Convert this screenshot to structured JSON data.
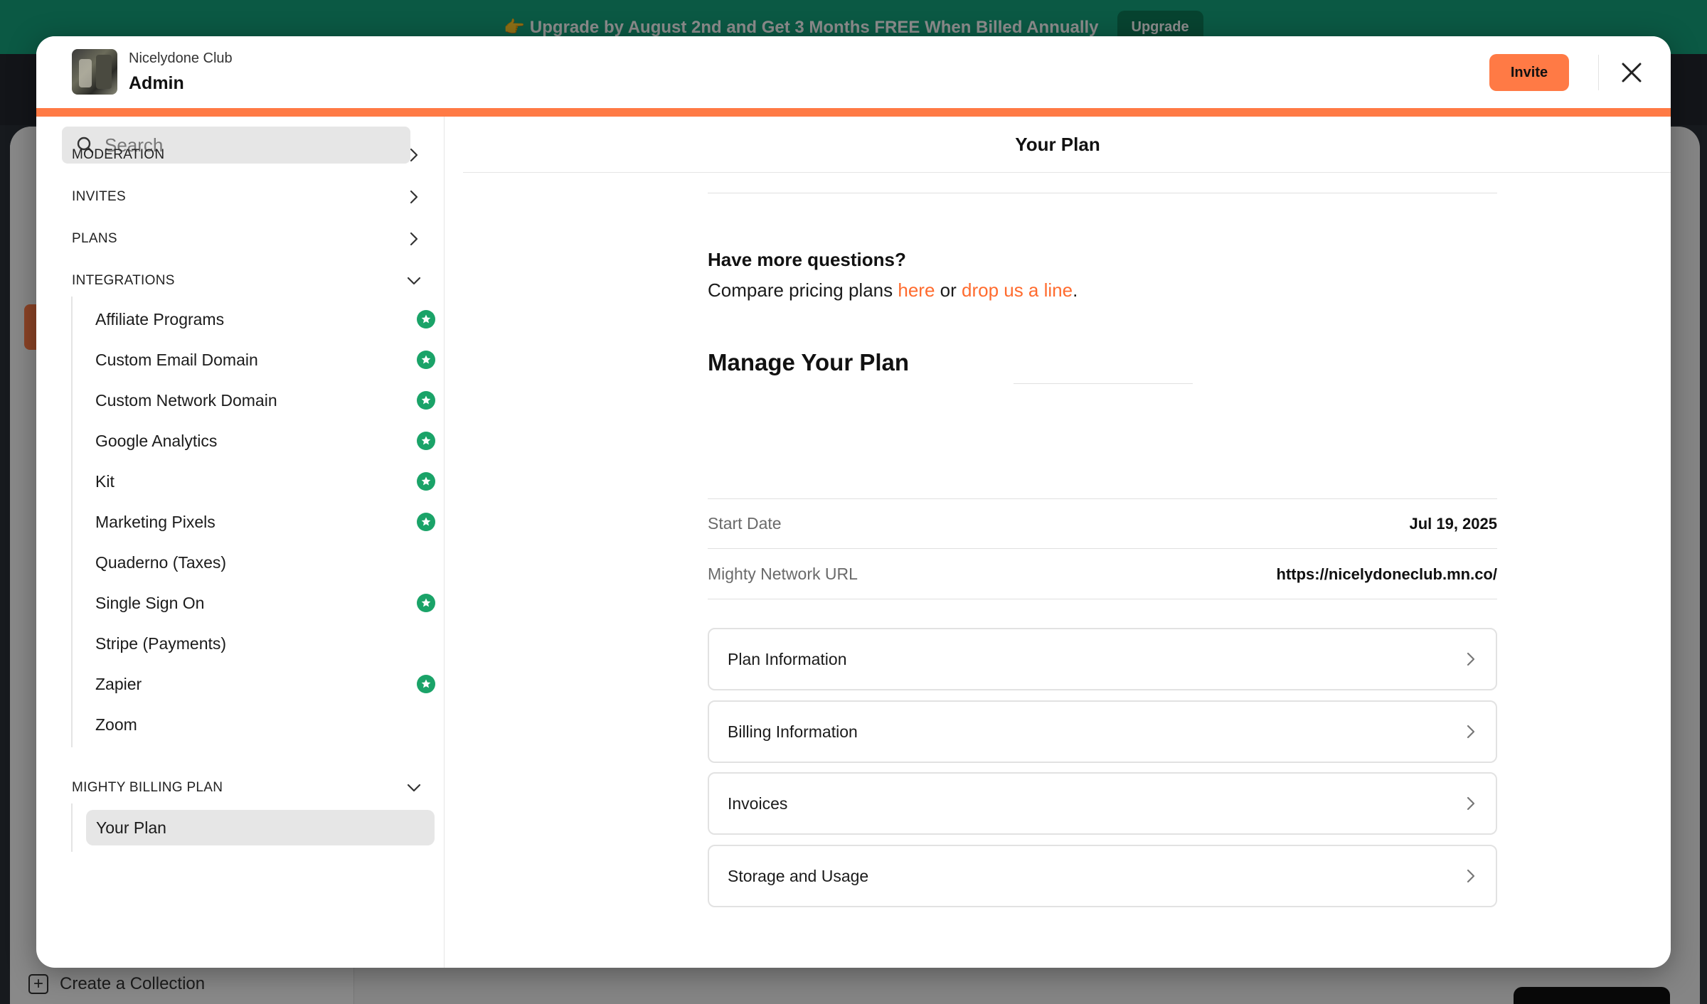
{
  "banner": {
    "emoji": "👉",
    "text": "Upgrade by August 2nd and Get 3 Months FREE When Billed Annually",
    "button": "Upgrade"
  },
  "background": {
    "footer_label": "Create a Collection"
  },
  "header": {
    "club_name": "Nicelydone Club",
    "title": "Admin",
    "invite_label": "Invite"
  },
  "sidebar": {
    "search_placeholder": "Search",
    "sections": [
      {
        "label": "MODERATION",
        "state": "collapsed"
      },
      {
        "label": "INVITES",
        "state": "collapsed"
      },
      {
        "label": "PLANS",
        "state": "collapsed"
      },
      {
        "label": "INTEGRATIONS",
        "state": "expanded"
      },
      {
        "label": "MIGHTY BILLING PLAN",
        "state": "expanded"
      }
    ],
    "integrations": [
      {
        "label": "Affiliate Programs",
        "badge": true
      },
      {
        "label": "Custom Email Domain",
        "badge": true
      },
      {
        "label": "Custom Network Domain",
        "badge": true
      },
      {
        "label": "Google Analytics",
        "badge": true
      },
      {
        "label": "Kit",
        "badge": true
      },
      {
        "label": "Marketing Pixels",
        "badge": true
      },
      {
        "label": "Quaderno (Taxes)",
        "badge": false
      },
      {
        "label": "Single Sign On",
        "badge": true
      },
      {
        "label": "Stripe (Payments)",
        "badge": false
      },
      {
        "label": "Zapier",
        "badge": true
      },
      {
        "label": "Zoom",
        "badge": false
      }
    ],
    "billing_items": [
      {
        "label": "Your Plan",
        "active": true
      }
    ]
  },
  "main": {
    "title": "Your Plan",
    "questions": {
      "heading": "Have more questions?",
      "prefix": "Compare pricing plans ",
      "link1": "here",
      "middle": " or ",
      "link2": "drop us a line",
      "suffix": "."
    },
    "manage_title": "Manage Your Plan",
    "details": [
      {
        "label": "Start Date",
        "value": "Jul 19, 2025"
      },
      {
        "label": "Mighty Network URL",
        "value": "https://nicelydoneclub.mn.co/"
      }
    ],
    "links": [
      {
        "label": "Plan Information"
      },
      {
        "label": "Billing Information"
      },
      {
        "label": "Invoices"
      },
      {
        "label": "Storage and Usage"
      }
    ]
  },
  "colors": {
    "accent": "#ff7a45",
    "link": "#ff6b2e",
    "badge": "#1aa368",
    "banner": "#15a37d"
  }
}
